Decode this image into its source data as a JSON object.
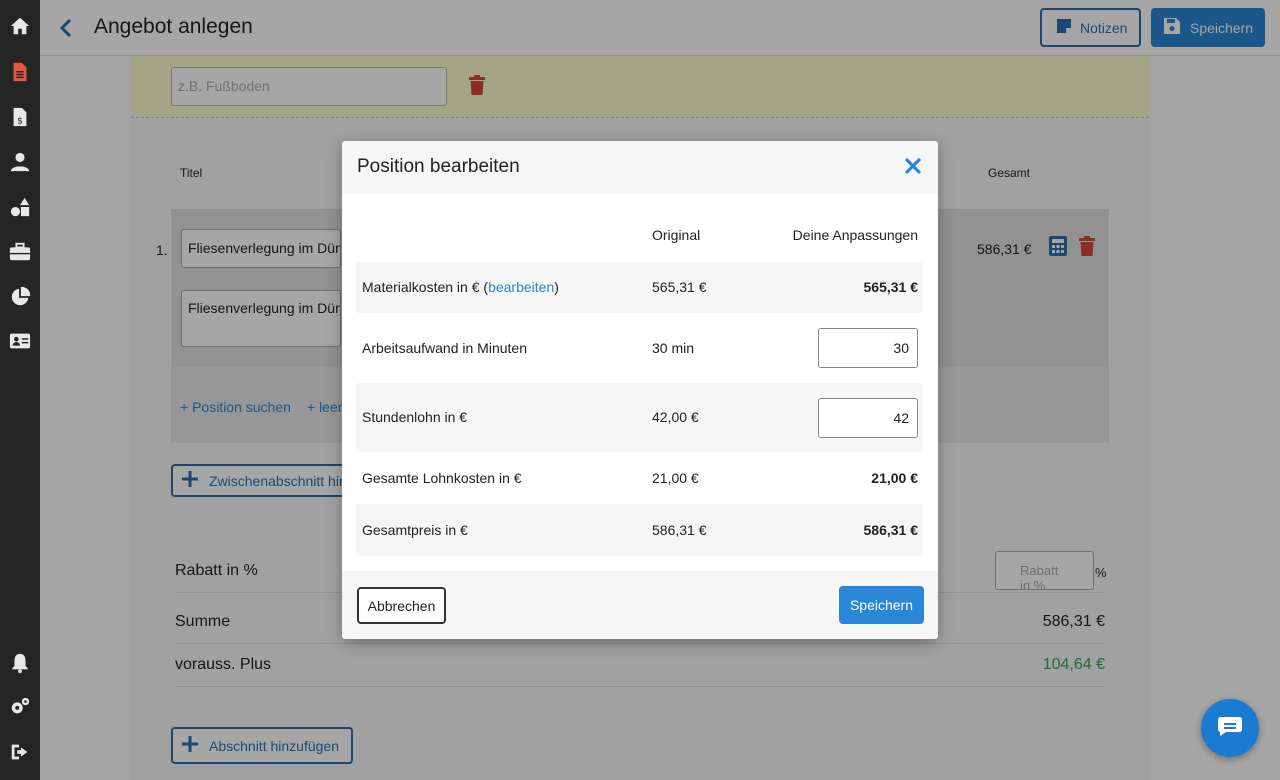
{
  "app": {
    "page_title": "Angebot anlegen",
    "notes_label": "Notizen",
    "save_label": "Speichern"
  },
  "sidebar": {
    "items": [
      {
        "icon": "home-icon"
      },
      {
        "icon": "document-icon",
        "active": true
      },
      {
        "icon": "invoice-icon"
      },
      {
        "icon": "user-icon"
      },
      {
        "icon": "shapes-icon"
      },
      {
        "icon": "toolbox-icon"
      },
      {
        "icon": "pie-chart-icon"
      },
      {
        "icon": "contact-card-icon"
      },
      {
        "icon": "bell-icon"
      },
      {
        "icon": "settings-icon"
      },
      {
        "icon": "logout-icon"
      }
    ]
  },
  "editor": {
    "section_placeholder": "z.B. Fußboden",
    "col_title": "Titel",
    "col_total": "Gesamt",
    "position": {
      "number": "1.",
      "title": "Fliesenverlegung im Dünnbett",
      "description": "Fliesenverlegung im Dünnbett",
      "total": "586,31 €"
    },
    "search_link": "+ Position suchen",
    "empty_link": "+ leere Position",
    "add_subsection": "Zwischenabschnitt hinzufügen",
    "rabatt_label": "Rabatt in %",
    "rabatt_placeholder": "Rabatt in %",
    "rabatt_unit": "%",
    "sum_label": "Summe",
    "sum_value": "586,31 €",
    "plus_label": "vorauss. Plus",
    "plus_value": "104,64 €",
    "add_section": "Abschnitt hinzufügen"
  },
  "modal": {
    "title": "Position bearbeiten",
    "head_original": "Original",
    "head_adjust": "Deine Anpassungen",
    "rows": [
      {
        "label": "Materialkosten in €",
        "edit_link": "bearbeiten",
        "original": "565,31 €",
        "adjusted": "565,31 €"
      },
      {
        "label": "Arbeitsaufwand in Minuten",
        "original": "30 min",
        "adjusted": "30"
      },
      {
        "label": "Stundenlohn in €",
        "original": "42,00 €",
        "adjusted": "42"
      },
      {
        "label": "Gesamte Lohnkosten in €",
        "original": "21,00 €",
        "adjusted": "21,00 €"
      },
      {
        "label": "Gesamtpreis in €",
        "original": "586,31 €",
        "adjusted": "586,31 €"
      }
    ],
    "cancel_label": "Abbrechen",
    "save_label": "Speichern"
  },
  "colors": {
    "accent": "#2a86d6",
    "danger": "#d9483b",
    "positive": "#2aa84a",
    "sidebar": "#252525"
  }
}
